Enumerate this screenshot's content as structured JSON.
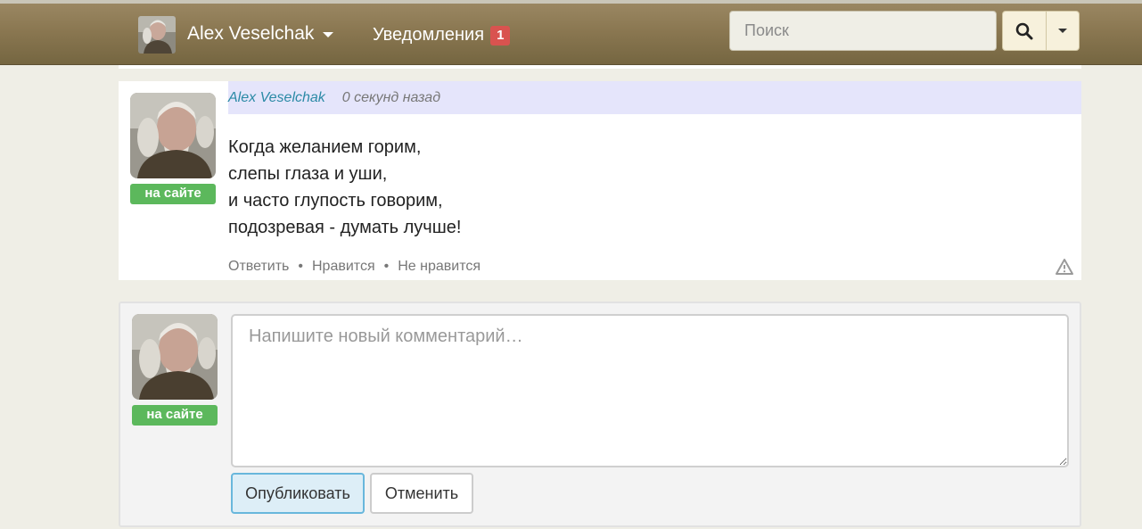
{
  "navbar": {
    "user_name": "Alex Veselchak",
    "notifications_label": "Уведомления",
    "notifications_count": "1",
    "search_placeholder": "Поиск",
    "icons": {
      "search": "search-icon",
      "dropdown": "caret-down-icon",
      "user_dropdown": "caret-down-icon"
    },
    "colors": {
      "navbar": "#8a7751",
      "badge": "#d9534f"
    }
  },
  "comment": {
    "author": "Alex Veselchak",
    "time": "0 секунд назад",
    "status": "на сайте",
    "lines": [
      "Когда желанием горим,",
      "слепы глаза и уши,",
      "и часто глупость говорим,",
      "подозревая - думать лучше!"
    ],
    "actions": {
      "reply": "Ответить",
      "like": "Нравится",
      "dislike": "Не нравится"
    },
    "separator": "•",
    "report_icon": "warning-triangle-icon"
  },
  "new_comment": {
    "status": "на сайте",
    "placeholder": "Напишите новый комментарий…",
    "publish_label": "Опубликовать",
    "cancel_label": "Отменить"
  },
  "colors": {
    "online_badge": "#5cb85c",
    "author_link": "#2b8aa6",
    "comment_header_bg": "#e5e5fb"
  }
}
